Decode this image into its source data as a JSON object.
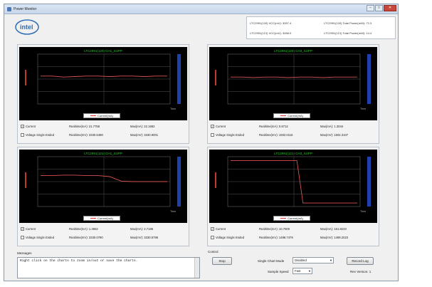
{
  "window": {
    "title": "Power Monitor",
    "min": "–",
    "max": "□",
    "close": "✕"
  },
  "logo": {
    "text": "intel"
  },
  "stats": [
    {
      "label": "LTC2991(120) VCC(mV): 3287.4"
    },
    {
      "label": "LTC2991(120) Total Power(mW): 72.3"
    },
    {
      "label": "LTC2991(121) VCC(mV): 3288.0"
    },
    {
      "label": "LTC2991(121) Total Power(mW): 14.4"
    }
  ],
  "panels": [
    {
      "chart_title": "LTC2991(120) CH1_SUPP",
      "legend": "Current(mA)",
      "current_label": "Current",
      "current_checked": true,
      "voltage_label": "Voltage Single Ended",
      "voltage_checked": false,
      "rt_current": "Realtime(mA): 21.7758",
      "max_current": "Max(mA): 22.1692",
      "rt_voltage": "Realtime(mV): 3330.6498",
      "max_voltage": "Max(mV): 3330.9001",
      "x_label": "Time",
      "level_frac": [
        0.44,
        0.44,
        0.46,
        0.45,
        0.44,
        0.44,
        0.45,
        0.44,
        0.44,
        0.45,
        0.44,
        0.44
      ]
    },
    {
      "chart_title": "LTC2991(120) CH3_SUPP",
      "legend": "Current(mA)",
      "current_label": "Current",
      "current_checked": true,
      "voltage_label": "Voltage Single Ended",
      "voltage_checked": false,
      "rt_current": "Realtime(mA): 0.8712",
      "max_current": "Max(mA): 1.3044",
      "rt_voltage": "Realtime(mV): 1502.0115",
      "max_voltage": "Max(mV): 1502.3107",
      "x_label": "Time",
      "level_frac": [
        0.46,
        0.46,
        0.47,
        0.46,
        0.46,
        0.47,
        0.46,
        0.46,
        0.47,
        0.46,
        0.46,
        0.46
      ]
    },
    {
      "chart_title": "LTC2991(121) CH1_SUPP",
      "legend": "Current(mA)",
      "current_label": "Current",
      "current_checked": true,
      "voltage_label": "Voltage Single Ended",
      "voltage_checked": false,
      "rt_current": "Realtime(mA): 1.3652",
      "max_current": "Max(mA): 2.7186",
      "rt_voltage": "Realtime(mV): 3330.0790",
      "max_voltage": "Max(mV): 3330.5796",
      "x_label": "Time",
      "level_frac": [
        0.38,
        0.38,
        0.37,
        0.37,
        0.38,
        0.38,
        0.4,
        0.49,
        0.5,
        0.5,
        0.5,
        0.5
      ]
    },
    {
      "chart_title": "LTC2991(121) CH3_SUPP",
      "legend": "Current(mA)",
      "current_label": "Current",
      "current_checked": true,
      "voltage_label": "Voltage Single Ended",
      "voltage_checked": false,
      "rt_current": "Realtime(mA): 10.7500",
      "max_current": "Max(mA): 161.8233",
      "rt_voltage": "Realtime(mV): 1498.7479",
      "max_voltage": "Max(mV): 1499.2023",
      "x_label": "Time",
      "level_frac": [
        0.08,
        0.08,
        0.08,
        0.08,
        0.08,
        0.08,
        0.08,
        0.08,
        0.08,
        0.08,
        0.08,
        0.08,
        0.93,
        0.93,
        0.93,
        0.93,
        0.93,
        0.93,
        0.93,
        0.93,
        0.93,
        0.93
      ]
    }
  ],
  "messages": {
    "label": "Messages",
    "text": "Right click on the charts to zoom in/out or save the charts."
  },
  "control": {
    "label": "Control",
    "stop": "Stop",
    "single_chart_mode_label": "Single Chart Mode",
    "single_chart_mode_value": "Disabled",
    "sample_speed_label": "Sample Speed",
    "sample_speed_value": "Fast",
    "record_log": "Record Log",
    "version": "Rev Version: 1"
  },
  "colors": {
    "line": "#d9534f",
    "ytitle": "#c0392b",
    "title": "#22cc22",
    "axis": "#2040b0"
  }
}
